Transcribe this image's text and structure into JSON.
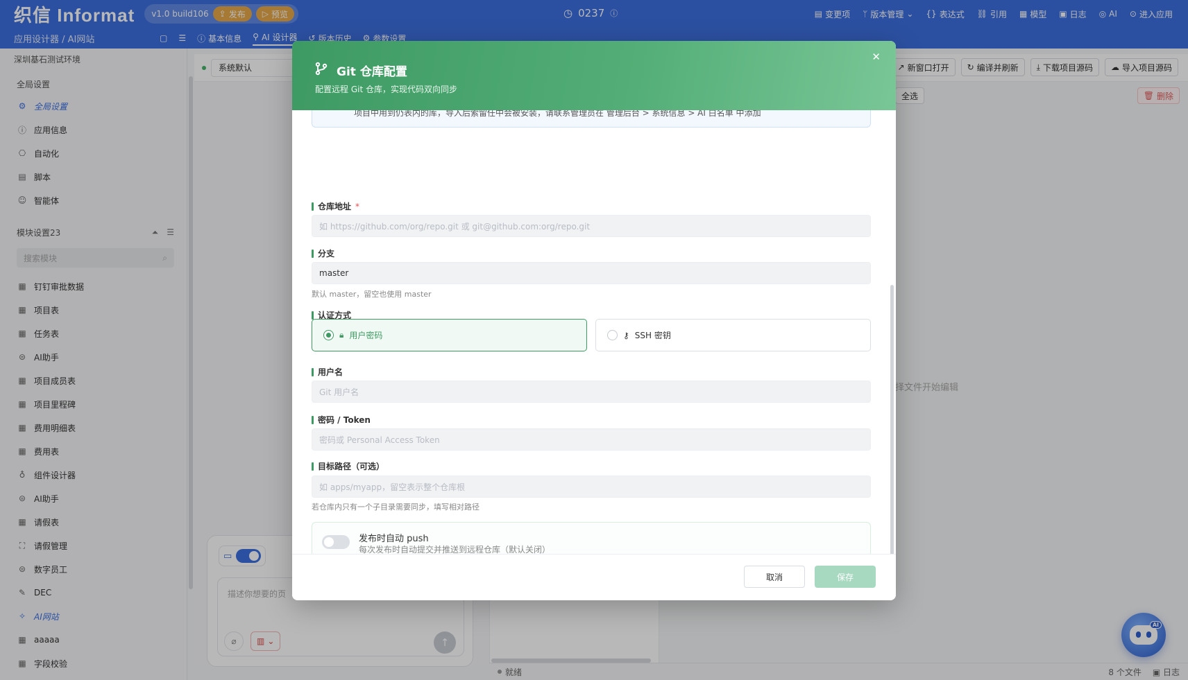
{
  "topbar": {
    "logo": "织信 Informat",
    "version": "v1.0 build106",
    "publish": "发布",
    "preview": "预览",
    "code": "0237",
    "actions": [
      "变更项",
      "版本管理",
      "表达式",
      "引用",
      "模型",
      "日志",
      "AI",
      "进入应用"
    ]
  },
  "subbar": {
    "breadcrumb": "应用设计器 / AI网站",
    "tabs": [
      "基本信息",
      "AI 设计器",
      "版本历史",
      "参数设置"
    ]
  },
  "sidebar": {
    "env": "深圳基石测试环境",
    "global_section": "全局设置",
    "global_items": [
      {
        "label": "全局设置",
        "icon": "gear-icon"
      },
      {
        "label": "应用信息",
        "icon": "info-icon"
      },
      {
        "label": "自动化",
        "icon": "automation-icon"
      },
      {
        "label": "脚本",
        "icon": "script-icon"
      },
      {
        "label": "智能体",
        "icon": "agent-icon"
      }
    ],
    "module_section": "模块设置23",
    "search_placeholder": "搜索模块",
    "modules": [
      {
        "label": "钉钉审批数据",
        "icon": "table-icon"
      },
      {
        "label": "项目表",
        "icon": "table-icon"
      },
      {
        "label": "任务表",
        "icon": "table-icon"
      },
      {
        "label": "AI助手",
        "icon": "robot-icon"
      },
      {
        "label": "项目成员表",
        "icon": "table-icon"
      },
      {
        "label": "项目里程碑",
        "icon": "table-icon"
      },
      {
        "label": "费用明细表",
        "icon": "table-icon"
      },
      {
        "label": "费用表",
        "icon": "table-icon"
      },
      {
        "label": "组件设计器",
        "icon": "bulb-icon"
      },
      {
        "label": "AI助手",
        "icon": "robot-icon"
      },
      {
        "label": "请假表",
        "icon": "table-icon"
      },
      {
        "label": "请假管理",
        "icon": "workflow-icon"
      },
      {
        "label": "数字员工",
        "icon": "robot-icon"
      },
      {
        "label": "DEC",
        "icon": "edit-icon"
      },
      {
        "label": "AI网站",
        "icon": "ai-site-icon"
      },
      {
        "label": "aaaaa",
        "icon": "table-icon"
      },
      {
        "label": "字段校验",
        "icon": "table-icon"
      }
    ],
    "active_module": "AI网站"
  },
  "main": {
    "system_select": "系统默认",
    "buttons": [
      "新窗口打开",
      "编译并刷新",
      "下载项目源码",
      "导入项目源码"
    ],
    "select_all": "全选",
    "delete": "删除",
    "hint": "择文件开始编辑",
    "chat_placeholder": "描述你想要的页",
    "status_ready": "就绪",
    "file_count": "8 个文件",
    "log": "日志"
  },
  "modal": {
    "title": "Git 仓库配置",
    "subtitle": "配置远程 Git 仓库，实现代码双向同步",
    "notice_text": "项目中用到仍表内的库，导入后索留任中会被安装，请联系管理员在 管理后台 > 系统信息 > AI 白名单 中添加",
    "repo_label": "仓库地址",
    "repo_required": "*",
    "repo_placeholder": "如 https://github.com/org/repo.git 或 git@github.com:org/repo.git",
    "branch_label": "分支",
    "branch_value": "master",
    "branch_help": "默认 master，留空也使用 master",
    "auth_label": "认证方式",
    "auth_options": [
      {
        "label": "用户密码",
        "icon": "lock-icon",
        "selected": true
      },
      {
        "label": "SSH 密钥",
        "icon": "key-icon",
        "selected": false
      }
    ],
    "username_label": "用户名",
    "username_placeholder": "Git 用户名",
    "password_label": "密码 / Token",
    "password_placeholder": "密码或 Personal Access Token",
    "path_label": "目标路径（可选）",
    "path_placeholder": "如 apps/myapp，留空表示整个仓库根",
    "path_help": "若仓库内只有一个子目录需要同步，填写相对路径",
    "auto_push_title": "发布时自动 push",
    "auto_push_desc": "每次发布时自动提交并推送到远程仓库（默认关闭）",
    "auto_push_enabled": false,
    "cancel": "取消",
    "save": "保存"
  },
  "colors": {
    "brand_blue": "#3d6fe0",
    "modal_green": "#3e9a63",
    "save_disabled": "#a7d8c0"
  }
}
